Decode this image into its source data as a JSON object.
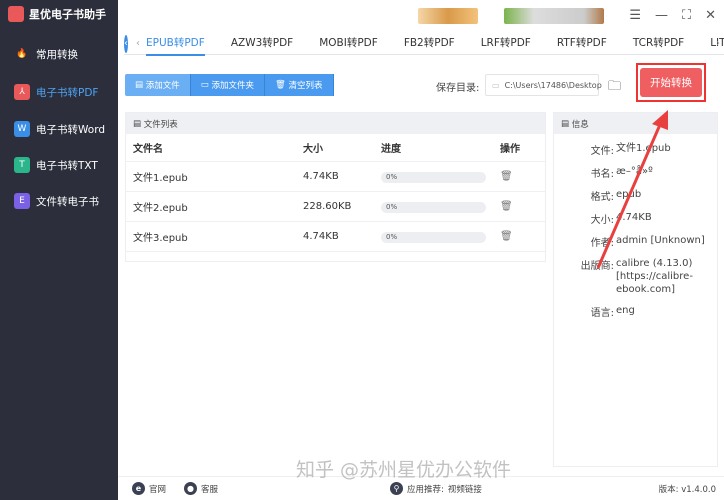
{
  "app": {
    "title": "星优电子书助手"
  },
  "sidebar": {
    "items": [
      {
        "label": "常用转换",
        "icon": "fire-icon",
        "color": "#e9595a"
      },
      {
        "label": "电子书转PDF",
        "icon": "pdf-icon",
        "color": "#e9595a",
        "active": true
      },
      {
        "label": "电子书转Word",
        "icon": "word-icon",
        "color": "#3a8ee6",
        "glyph": "W"
      },
      {
        "label": "电子书转TXT",
        "icon": "txt-icon",
        "color": "#2bb58a",
        "glyph": "T"
      },
      {
        "label": "文件转电子书",
        "icon": "ebook-icon",
        "color": "#7b61e6",
        "glyph": "E"
      }
    ]
  },
  "tabs": [
    "EPUB转PDF",
    "AZW3转PDF",
    "MOBI转PDF",
    "FB2转PDF",
    "LRF转PDF",
    "RTF转PDF",
    "TCR转PDF",
    "LIT转"
  ],
  "toolbar": {
    "add_file": "添加文件",
    "add_folder": "添加文件夹",
    "clear": "清空列表"
  },
  "save": {
    "label": "保存目录:",
    "path": "C:\\Users\\17486\\Desktop"
  },
  "start_label": "开始转换",
  "file_list": {
    "title": "文件列表",
    "columns": [
      "文件名",
      "大小",
      "进度",
      "操作"
    ],
    "rows": [
      {
        "name": "文件1.epub",
        "size": "4.74KB",
        "progress": "0%"
      },
      {
        "name": "文件2.epub",
        "size": "228.60KB",
        "progress": "0%"
      },
      {
        "name": "文件3.epub",
        "size": "4.74KB",
        "progress": "0%"
      }
    ]
  },
  "info": {
    "title": "信息",
    "fields": [
      {
        "k": "文件:",
        "v": "文件1.epub"
      },
      {
        "k": "书名:",
        "v": "æ–°å»º"
      },
      {
        "k": "格式:",
        "v": "epub"
      },
      {
        "k": "大小:",
        "v": "4.74KB"
      },
      {
        "k": "作者:",
        "v": "admin [Unknown]"
      },
      {
        "k": "出版商:",
        "v": "calibre (4.13.0) [https://calibre-ebook.com]"
      },
      {
        "k": "语言:",
        "v": "eng"
      }
    ]
  },
  "footer": {
    "website": "官网",
    "support": "客服",
    "recommend": "应用推荐:",
    "video": "视频链接",
    "version": "版本: v1.4.0.0"
  },
  "watermark": "知乎 @苏州星优办公软件"
}
